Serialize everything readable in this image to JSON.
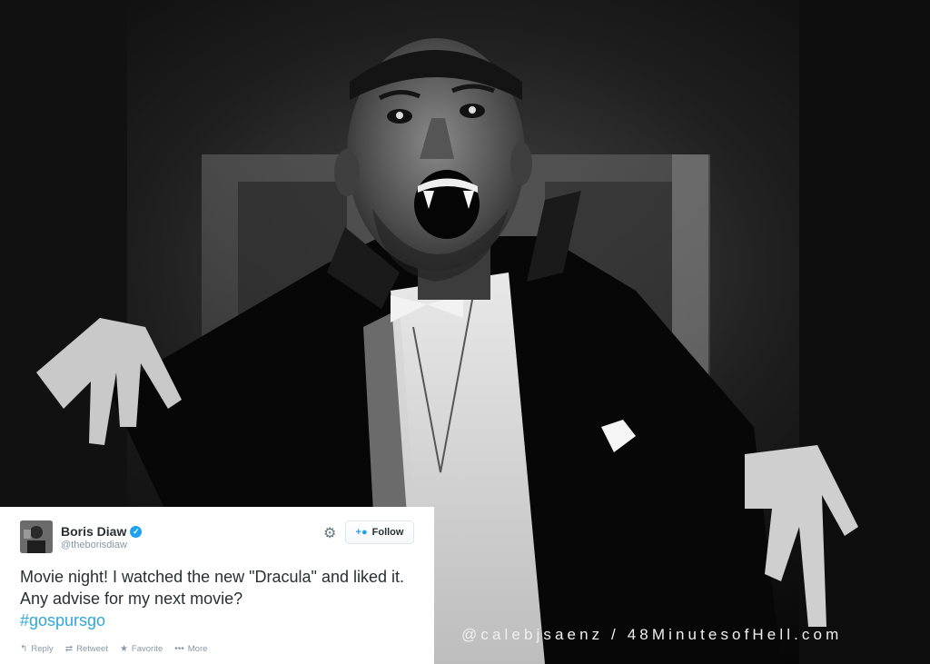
{
  "tweet": {
    "author_name": "Boris Diaw",
    "handle": "@theborisdiaw",
    "text": "Movie night! I watched the new \"Dracula\" and liked it. Any advise for my next movie?",
    "hashtag": "#gospursgo",
    "follow_label": "Follow",
    "actions": {
      "reply": "Reply",
      "retweet": "Retweet",
      "favorite": "Favorite",
      "more": "More"
    },
    "icons": {
      "verified": "verified-badge-icon",
      "settings": "gear-icon",
      "follow": "add-user-icon",
      "reply": "reply-icon",
      "retweet": "retweet-icon",
      "favorite": "star-icon",
      "more": "more-dots-icon"
    },
    "colors": {
      "link": "#2fa8d8",
      "verified": "#1da1f2",
      "text": "#292f33",
      "muted": "#8899a6"
    }
  },
  "watermark": {
    "credit": "@calebjsaenz / 48MinutesofHell.com"
  }
}
